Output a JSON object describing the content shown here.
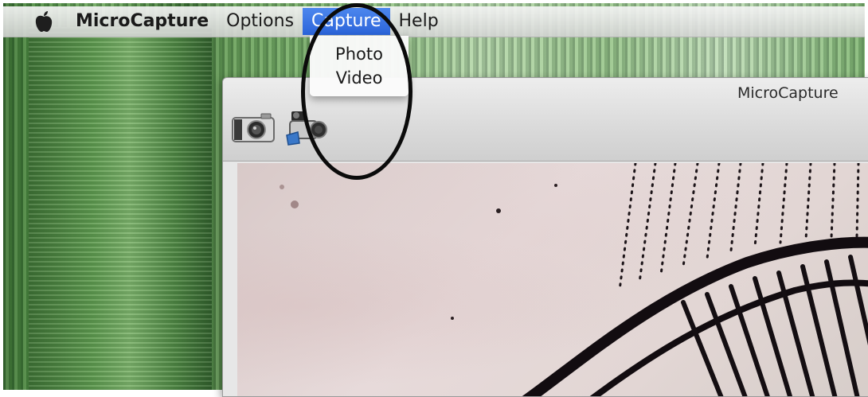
{
  "menubar": {
    "apple_icon": "apple-icon",
    "app_name": "MicroCapture",
    "items": [
      {
        "label": "Options"
      },
      {
        "label": "Capture",
        "active": true
      },
      {
        "label": "Help"
      }
    ]
  },
  "capture_menu": {
    "items": [
      {
        "label": "Photo"
      },
      {
        "label": "Video"
      }
    ]
  },
  "window": {
    "title": "MicroCapture",
    "toolbar": {
      "photo_icon": "camera-icon",
      "video_icon": "video-camera-icon"
    }
  },
  "colors": {
    "menu_highlight": "#2f6bde",
    "annotation": "#0b0b0b"
  }
}
